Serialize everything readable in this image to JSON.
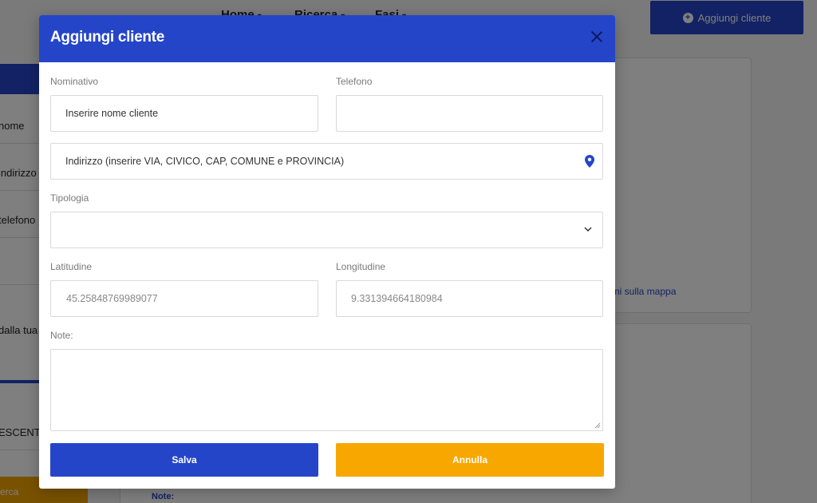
{
  "background": {
    "nav": {
      "items": [
        {
          "label": "Home"
        },
        {
          "label": "Ricerca"
        },
        {
          "label": "Fasi"
        }
      ],
      "add_client_label": "Aggiungi cliente"
    },
    "sidebar": {
      "items": [
        "nome",
        "indirizzo",
        "telefono",
        "",
        "",
        "dalla tua",
        "",
        "ESCENTE"
      ],
      "search_button": "erca"
    },
    "map_link": "ami sulla mappa",
    "note_label": "Note:"
  },
  "modal": {
    "title": "Aggiungi cliente",
    "fields": {
      "nominativo": {
        "label": "Nominativo",
        "placeholder": "Inserire nome cliente",
        "value": ""
      },
      "telefono": {
        "label": "Telefono",
        "value": ""
      },
      "indirizzo": {
        "placeholder": "Indirizzo (inserire VIA, CIVICO, CAP, COMUNE e PROVINCIA)"
      },
      "tipologia": {
        "label": "Tipologia",
        "value": ""
      },
      "latitudine": {
        "label": "Latitudine",
        "value": "45.25848769989077"
      },
      "longitudine": {
        "label": "Longitudine",
        "value": "9.331394664180984"
      },
      "note": {
        "label": "Note:",
        "value": ""
      }
    },
    "buttons": {
      "save": "Salva",
      "cancel": "Annulla"
    }
  },
  "colors": {
    "primary": "#2545c9",
    "accent": "#f7a700"
  },
  "icons": {
    "close": "close-icon",
    "location": "map-pin-icon",
    "dropdown": "chevron-down-icon",
    "add": "plus-circle-icon"
  }
}
